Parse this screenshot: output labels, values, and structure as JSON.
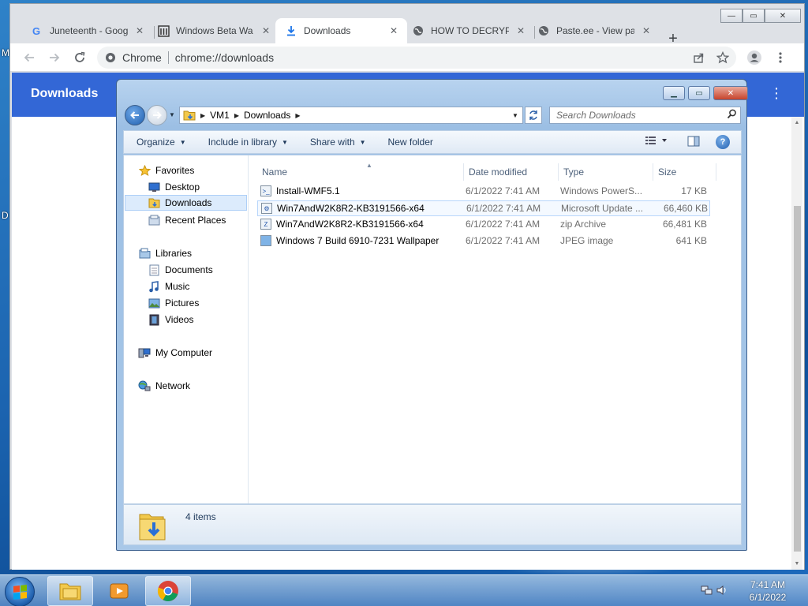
{
  "desktop": {
    "letter_m": "M",
    "letter_d": "D"
  },
  "browser": {
    "tabs": [
      {
        "title": "Juneteenth - Goog",
        "icon": "google-icon"
      },
      {
        "title": "Windows Beta Wa",
        "icon": "building-icon"
      },
      {
        "title": "Downloads",
        "icon": "download-icon",
        "active": true
      },
      {
        "title": "HOW TO DECRYPT",
        "icon": "globe-icon"
      },
      {
        "title": "Paste.ee - View pa",
        "icon": "globe-icon"
      }
    ],
    "close_glyph": "✕",
    "new_tab": "+",
    "omnibox": {
      "chip": "Chrome",
      "url": "chrome://downloads"
    },
    "page_title": "Downloads",
    "menu_glyph": "⋮"
  },
  "explorer": {
    "breadcrumb": [
      "VM1",
      "Downloads"
    ],
    "search_placeholder": "Search Downloads",
    "commands": [
      {
        "label": "Organize",
        "dropdown": true
      },
      {
        "label": "Include in library",
        "dropdown": true
      },
      {
        "label": "Share with",
        "dropdown": true
      },
      {
        "label": "New folder",
        "dropdown": false
      }
    ],
    "nav": {
      "favorites_label": "Favorites",
      "favorites": [
        "Desktop",
        "Downloads",
        "Recent Places"
      ],
      "libraries_label": "Libraries",
      "libraries": [
        "Documents",
        "Music",
        "Pictures",
        "Videos"
      ],
      "computer": "My Computer",
      "network": "Network"
    },
    "columns": {
      "name": "Name",
      "date": "Date modified",
      "type": "Type",
      "size": "Size"
    },
    "files": [
      {
        "name": "Install-WMF5.1",
        "date": "6/1/2022 7:41 AM",
        "type": "Windows PowerS...",
        "size": "17 KB",
        "icon": "script-file-icon"
      },
      {
        "name": "Win7AndW2K8R2-KB3191566-x64",
        "date": "6/1/2022 7:41 AM",
        "type": "Microsoft Update ...",
        "size": "66,460 KB",
        "icon": "update-file-icon"
      },
      {
        "name": "Win7AndW2K8R2-KB3191566-x64",
        "date": "6/1/2022 7:41 AM",
        "type": "zip Archive",
        "size": "66,481 KB",
        "icon": "zip-file-icon"
      },
      {
        "name": "Windows 7 Build 6910-7231 Wallpaper",
        "date": "6/1/2022 7:41 AM",
        "type": "JPEG image",
        "size": "641 KB",
        "icon": "image-file-icon"
      }
    ],
    "status": "4 items"
  },
  "taskbar": {
    "time": "7:41 AM",
    "date": "6/1/2022"
  }
}
